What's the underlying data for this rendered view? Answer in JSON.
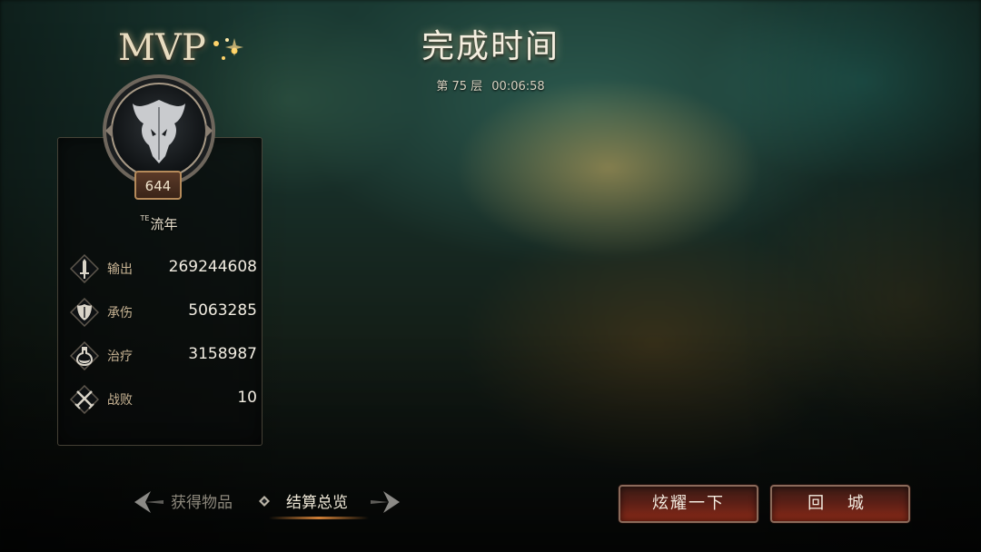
{
  "header": {
    "title": "完成时间",
    "floor_label": "第 75 层",
    "elapsed": "00:06:58"
  },
  "mvp": {
    "badge_text": "MVP",
    "level": "644",
    "name_prefix": "TE",
    "name": "流年"
  },
  "stats": [
    {
      "icon": "sword-icon",
      "label": "输出",
      "value": "269244608"
    },
    {
      "icon": "shield-icon",
      "label": "承伤",
      "value": "5063285"
    },
    {
      "icon": "potion-icon",
      "label": "治疗",
      "value": "3158987"
    },
    {
      "icon": "crossed-swords-icon",
      "label": "战败",
      "value": "10"
    }
  ],
  "tabs": {
    "items": [
      "获得物品",
      "结算总览"
    ],
    "selected": "结算总览"
  },
  "buttons": {
    "show_off": "炫耀一下",
    "return_city": "回 城"
  },
  "colors": {
    "accent_gold": "#c8b494",
    "button_red": "#8a2a18"
  }
}
